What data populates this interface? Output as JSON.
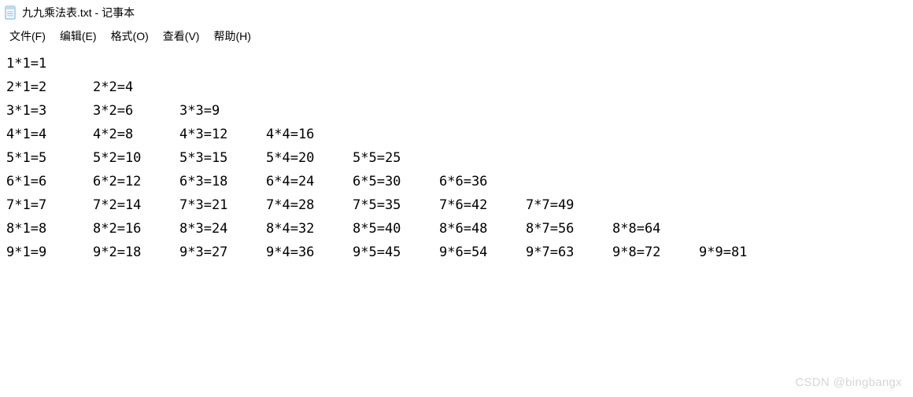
{
  "window": {
    "title": "九九乘法表.txt - 记事本"
  },
  "menu": {
    "file": "文件(F)",
    "edit": "编辑(E)",
    "format": "格式(O)",
    "view": "查看(V)",
    "help": "帮助(H)"
  },
  "content": {
    "rows": [
      [
        "1*1=1"
      ],
      [
        "2*1=2",
        "2*2=4"
      ],
      [
        "3*1=3",
        "3*2=6",
        "3*3=9"
      ],
      [
        "4*1=4",
        "4*2=8",
        "4*3=12",
        "4*4=16"
      ],
      [
        "5*1=5",
        "5*2=10",
        "5*3=15",
        "5*4=20",
        "5*5=25"
      ],
      [
        "6*1=6",
        "6*2=12",
        "6*3=18",
        "6*4=24",
        "6*5=30",
        "6*6=36"
      ],
      [
        "7*1=7",
        "7*2=14",
        "7*3=21",
        "7*4=28",
        "7*5=35",
        "7*6=42",
        "7*7=49"
      ],
      [
        "8*1=8",
        "8*2=16",
        "8*3=24",
        "8*4=32",
        "8*5=40",
        "8*6=48",
        "8*7=56",
        "8*8=64"
      ],
      [
        "9*1=9",
        "9*2=18",
        "9*3=27",
        "9*4=36",
        "9*5=45",
        "9*6=54",
        "9*7=63",
        "9*8=72",
        "9*9=81"
      ]
    ]
  },
  "watermark": "CSDN @bingbangx"
}
